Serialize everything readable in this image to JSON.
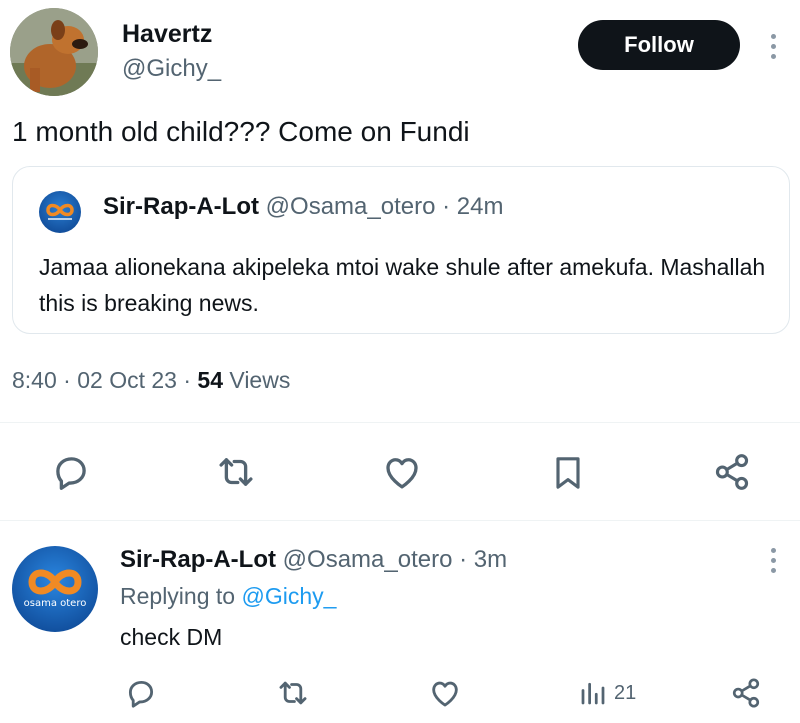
{
  "tweet": {
    "author": {
      "display_name": "Havertz",
      "handle": "@Gichy_"
    },
    "follow_label": "Follow",
    "text": "1 month old child??? Come on Fundi",
    "quote": {
      "display_name": "Sir-Rap-A-Lot",
      "handle": "@Osama_otero",
      "separator": "·",
      "age": "24m",
      "body": "Jamaa alionekana akipeleka mtoi wake shule after amekufa. Mashallah this is breaking news."
    },
    "time": "8:40",
    "date": "02 Oct 23",
    "views_count": "54",
    "views_label": "Views",
    "separator": "·",
    "actions": [
      "reply-icon",
      "retweet-icon",
      "like-icon",
      "bookmark-icon",
      "share-icon"
    ]
  },
  "reply": {
    "display_name": "Sir-Rap-A-Lot",
    "handle": "@Osama_otero",
    "separator": "·",
    "age": "3m",
    "replying_prefix": "Replying to",
    "replying_to": "@Gichy_",
    "text": "check DM",
    "avatar_text": "osama otero",
    "views_count": "21",
    "actions": [
      "reply-icon",
      "retweet-icon",
      "like-icon",
      "analytics-icon",
      "share-icon"
    ]
  },
  "colors": {
    "text": "#0f1419",
    "muted": "#536471",
    "link": "#1d9bf0",
    "button": "#0f1419"
  }
}
